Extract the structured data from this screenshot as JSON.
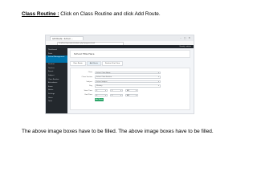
{
  "heading": {
    "label": "Class Routine :",
    "instruction": " Click on Class Routine and click Add Route."
  },
  "screenshot": {
    "browser_tab": "Add Route ‹ School …",
    "window_controls": "–  ▢  ✕",
    "address": "localhost/wp-admin/admin.php?page=school",
    "admin_user": "Howdy, admin",
    "sidebar_items": [
      "Dashboard",
      "Posts",
      "Media",
      "Pages",
      "Comments",
      "Student",
      "Teacher",
      "Parent",
      "Subject",
      "Class Routine",
      "Attendance",
      "Exam",
      "Notice",
      "Settings",
      "Users",
      "Tools"
    ],
    "active_item": "School Management",
    "page_title": "School Title Here",
    "tabs": [
      "Class Route",
      "Add Route",
      "Routine Print View"
    ],
    "form_fields": [
      {
        "label": "Class",
        "value": "Select Class Name"
      },
      {
        "label": "Class Section",
        "value": "Select Class Section"
      },
      {
        "label": "Subject",
        "value": "Select Subject"
      },
      {
        "label": "Day",
        "value": "Monday"
      }
    ],
    "time_rows": [
      {
        "label": "Start Time",
        "values": [
          "0",
          "0",
          "AM"
        ]
      },
      {
        "label": "End Time",
        "values": [
          "0",
          "0",
          "AM"
        ]
      }
    ],
    "submit_label": "Add Route"
  },
  "caption": "The above image boxes have to be filled. The above image boxes have to be filled."
}
